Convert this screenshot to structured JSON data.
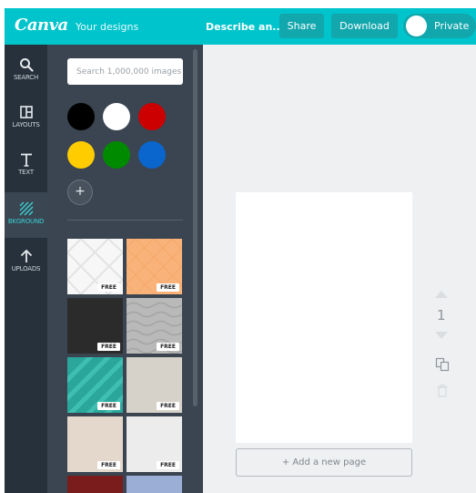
{
  "header": {
    "logo": "Canva",
    "your_designs": "Your designs",
    "doc_title": "Describe an...",
    "share_label": "Share",
    "download_label": "Download",
    "private_label": "Private",
    "accent_color": "#00c4cc"
  },
  "rail": {
    "items": [
      {
        "label": "SEARCH",
        "icon": "search-icon"
      },
      {
        "label": "LAYOUTS",
        "icon": "layouts-icon"
      },
      {
        "label": "TEXT",
        "icon": "text-icon"
      },
      {
        "label": "BKGROUND",
        "icon": "background-icon",
        "active": true
      },
      {
        "label": "UPLOADS",
        "icon": "upload-icon"
      }
    ]
  },
  "panel": {
    "search_placeholder": "Search 1,000,000 images",
    "colors": [
      "#000000",
      "#ffffff",
      "#cc0000",
      "#ffcc00",
      "#008a00",
      "#0a66cc"
    ],
    "add_color_label": "+",
    "backgrounds": [
      {
        "name": "white-diamond",
        "badge": "FREE"
      },
      {
        "name": "peach-diamond",
        "badge": "FREE"
      },
      {
        "name": "dark-texture",
        "badge": "FREE"
      },
      {
        "name": "grey-wave",
        "badge": "FREE"
      },
      {
        "name": "teal-stripes",
        "badge": "FREE"
      },
      {
        "name": "beige-texture",
        "badge": "FREE"
      },
      {
        "name": "cream-texture",
        "badge": "FREE"
      },
      {
        "name": "white-marble",
        "badge": "FREE"
      }
    ]
  },
  "canvas": {
    "page_number": "1",
    "add_page_label": "+ Add a new page"
  }
}
